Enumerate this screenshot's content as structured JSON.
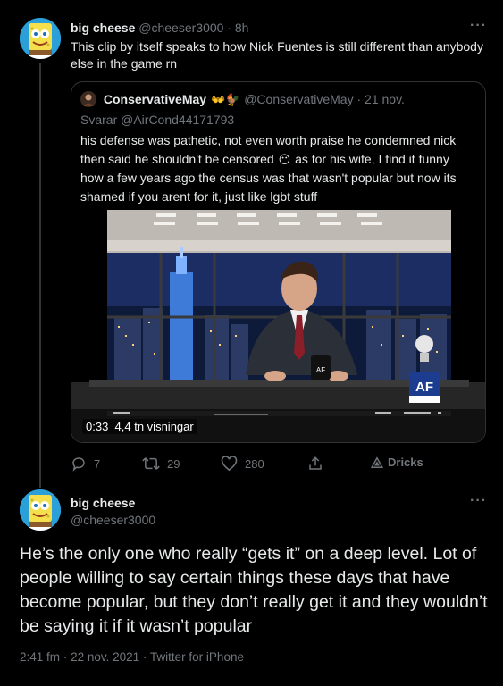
{
  "colors": {
    "background": "#000000",
    "text_primary": "#e7e9ea",
    "text_secondary": "#71767b",
    "border": "#2f3336"
  },
  "tweet1": {
    "author_name": "big cheese",
    "handle": "@cheeser3000",
    "separator": "·",
    "time": "8h",
    "more_icon": "more-dots-icon",
    "more_label": "···",
    "text": "This clip by itself speaks to how Nick Fuentes is still different than anybody else in the game rn"
  },
  "quote": {
    "author_name": "ConservativeMay",
    "name_emojis": "👐🐓",
    "handle": "@ConservativeMay",
    "separator": "·",
    "date": "21 nov.",
    "reply_prefix": "Svarar",
    "reply_handle": "@AirCond44171793",
    "text_part1": "his defense was pathetic, not even worth praise he condemned nick then said he shouldn't be censored",
    "inline_emoji": "😶",
    "text_part2": "as for his wife, I find it funny how a few years ago the census was that wasn't popular but now its shamed if you arent for it, just like lgbt stuff",
    "video": {
      "duration": "0:33",
      "views": "4,4 tn visningar",
      "logo_text": "AF"
    }
  },
  "actions": {
    "reply_count": "7",
    "retweet_count": "29",
    "like_count": "280",
    "promote_label": "Dricks"
  },
  "tweet2": {
    "author_name": "big cheese",
    "handle": "@cheeser3000",
    "more_label": "···",
    "text": "He’s the only one who really “gets it” on a deep level. Lot of people willing to say certain things these days that have become popular, but they don’t really get it and they wouldn’t be saying it if it wasn’t popular",
    "time": "2:41 fm",
    "separator": "·",
    "date": "22 nov. 2021",
    "source": "Twitter for iPhone"
  }
}
